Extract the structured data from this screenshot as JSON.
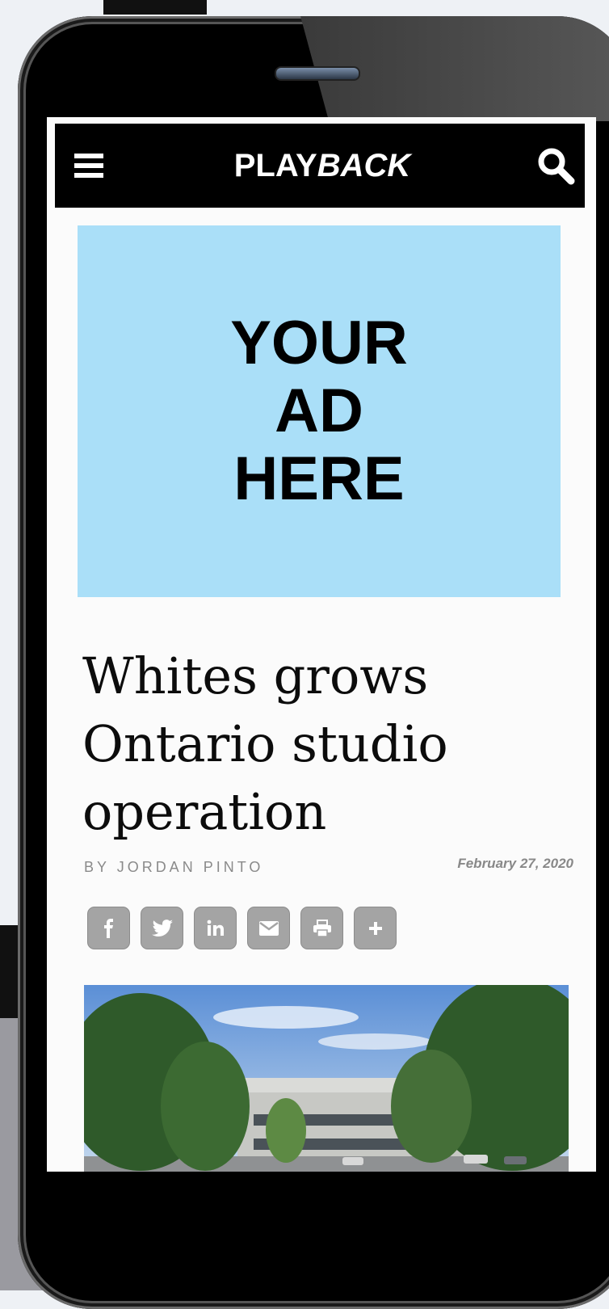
{
  "site": {
    "logo_bold": "PLAY",
    "logo_italic": "BACK"
  },
  "ad": {
    "line1": "YOUR",
    "line2": "AD",
    "line3": "HERE"
  },
  "article": {
    "headline": "Whites grows Ontario studio operation",
    "byline": "BY JORDAN PINTO",
    "date": "February 27, 2020"
  },
  "share_buttons": [
    "facebook",
    "twitter",
    "linkedin",
    "email",
    "print",
    "more"
  ],
  "colors": {
    "ad_bg": "#aadff8",
    "topbar_bg": "#000000",
    "share_btn": "#a4a4a4"
  }
}
